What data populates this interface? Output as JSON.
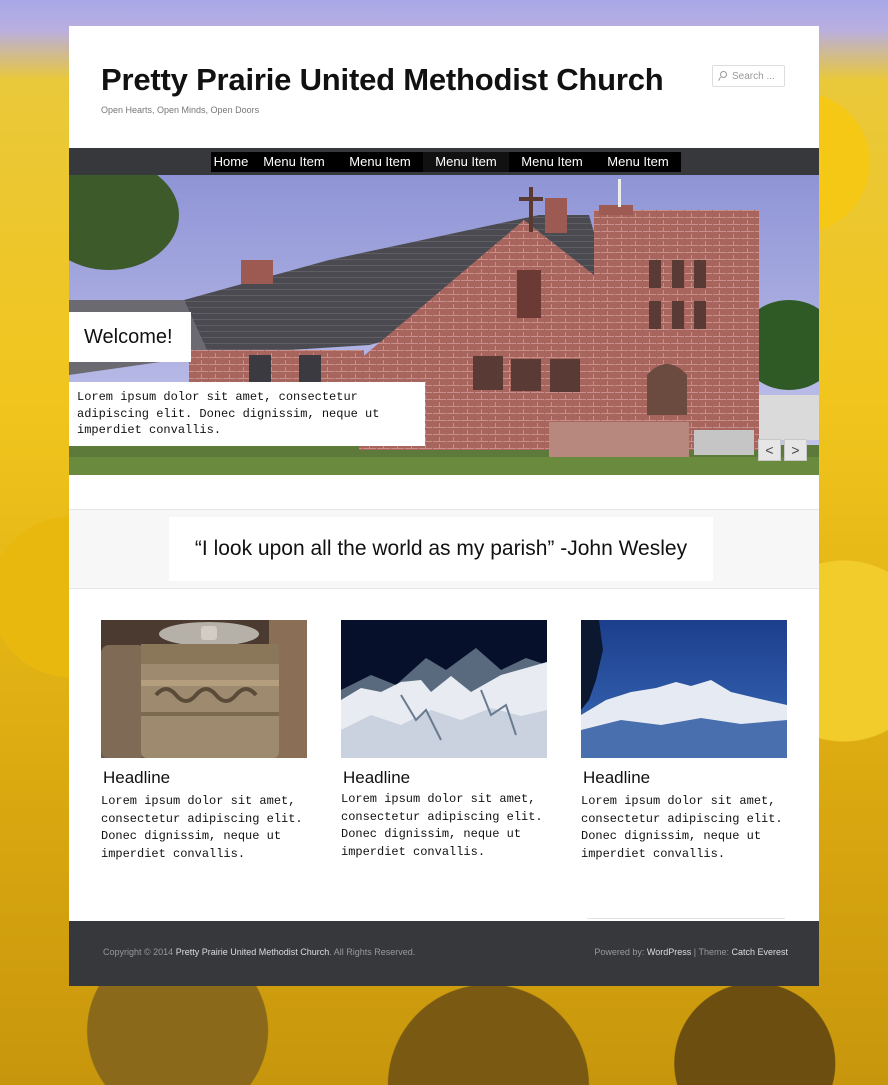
{
  "header": {
    "title": "Pretty Prairie United Methodist Church",
    "tagline": "Open Hearts, Open Minds, Open Doors",
    "search_placeholder": "Search ..."
  },
  "nav": {
    "items": [
      "Home",
      "Menu Item",
      "Menu Item",
      "Menu Item",
      "Menu Item",
      "Menu Item"
    ],
    "active_index": 3
  },
  "slider": {
    "welcome": "Welcome!",
    "caption": "Lorem ipsum dolor sit amet, consectetur adipiscing elit. Donec dignissim, neque ut imperdiet convallis.",
    "prev_label": "<",
    "next_label": ">"
  },
  "quote": "“I look upon all the world as my parish” -John Wesley",
  "columns": [
    {
      "image": "prayer-wheels",
      "headline": "Headline",
      "body": "Lorem ipsum dolor sit amet, consectetur adipiscing elit. Donec dignissim, neque ut imperdiet convallis."
    },
    {
      "image": "snowy-mountains",
      "headline": "Headline",
      "body": "Lorem ipsum dolor sit amet, consectetur adipiscing elit. Donec dignissim, neque ut imperdiet convallis."
    },
    {
      "image": "mountain-range",
      "headline": "Headline",
      "body": "Lorem ipsum dolor sit amet, consectetur adipiscing elit. Donec dignissim, neque ut imperdiet convallis."
    }
  ],
  "footer": {
    "copyright_prefix": "Copyright © 2014",
    "copyright_name": "Pretty Prairie United Methodist Church",
    "copyright_suffix": ". All Rights Reserved.",
    "powered_prefix": "Powered by:",
    "powered_name": "WordPress",
    "theme_prefix": "| Theme:",
    "theme_name": "Catch Everest"
  },
  "colors": {
    "nav_bar": "#37383c",
    "footer": "#37383c",
    "page_bg": "#ffffff"
  }
}
